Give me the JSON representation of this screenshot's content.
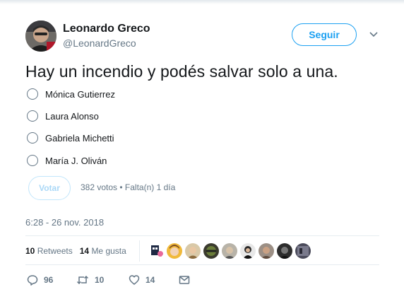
{
  "author": {
    "name": "Leonardo Greco",
    "handle": "@LeonardGreco"
  },
  "follow_label": "Seguir",
  "tweet_text": "Hay un incendio y podés salvar solo a una.",
  "poll": {
    "options": [
      "Mónica Gutierrez",
      "Laura Alonso",
      "Gabriela Michetti",
      "María J. Oliván"
    ],
    "vote_label": "Votar",
    "meta": "382 votos • Falta(n) 1 día"
  },
  "timestamp": "6:28 - 26 nov. 2018",
  "stats": {
    "retweets_count": "10",
    "retweets_label": "Retweets",
    "likes_count": "14",
    "likes_label": "Me gusta"
  },
  "actions": {
    "replies": "96",
    "retweets": "10",
    "likes": "14"
  },
  "colors": {
    "accent": "#1da1f2",
    "muted": "#657786",
    "text": "#14171a",
    "divider": "#e6ecf0"
  },
  "icons": [
    "reply-icon",
    "retweet-icon",
    "heart-icon",
    "envelope-icon",
    "chevron-down-icon"
  ]
}
